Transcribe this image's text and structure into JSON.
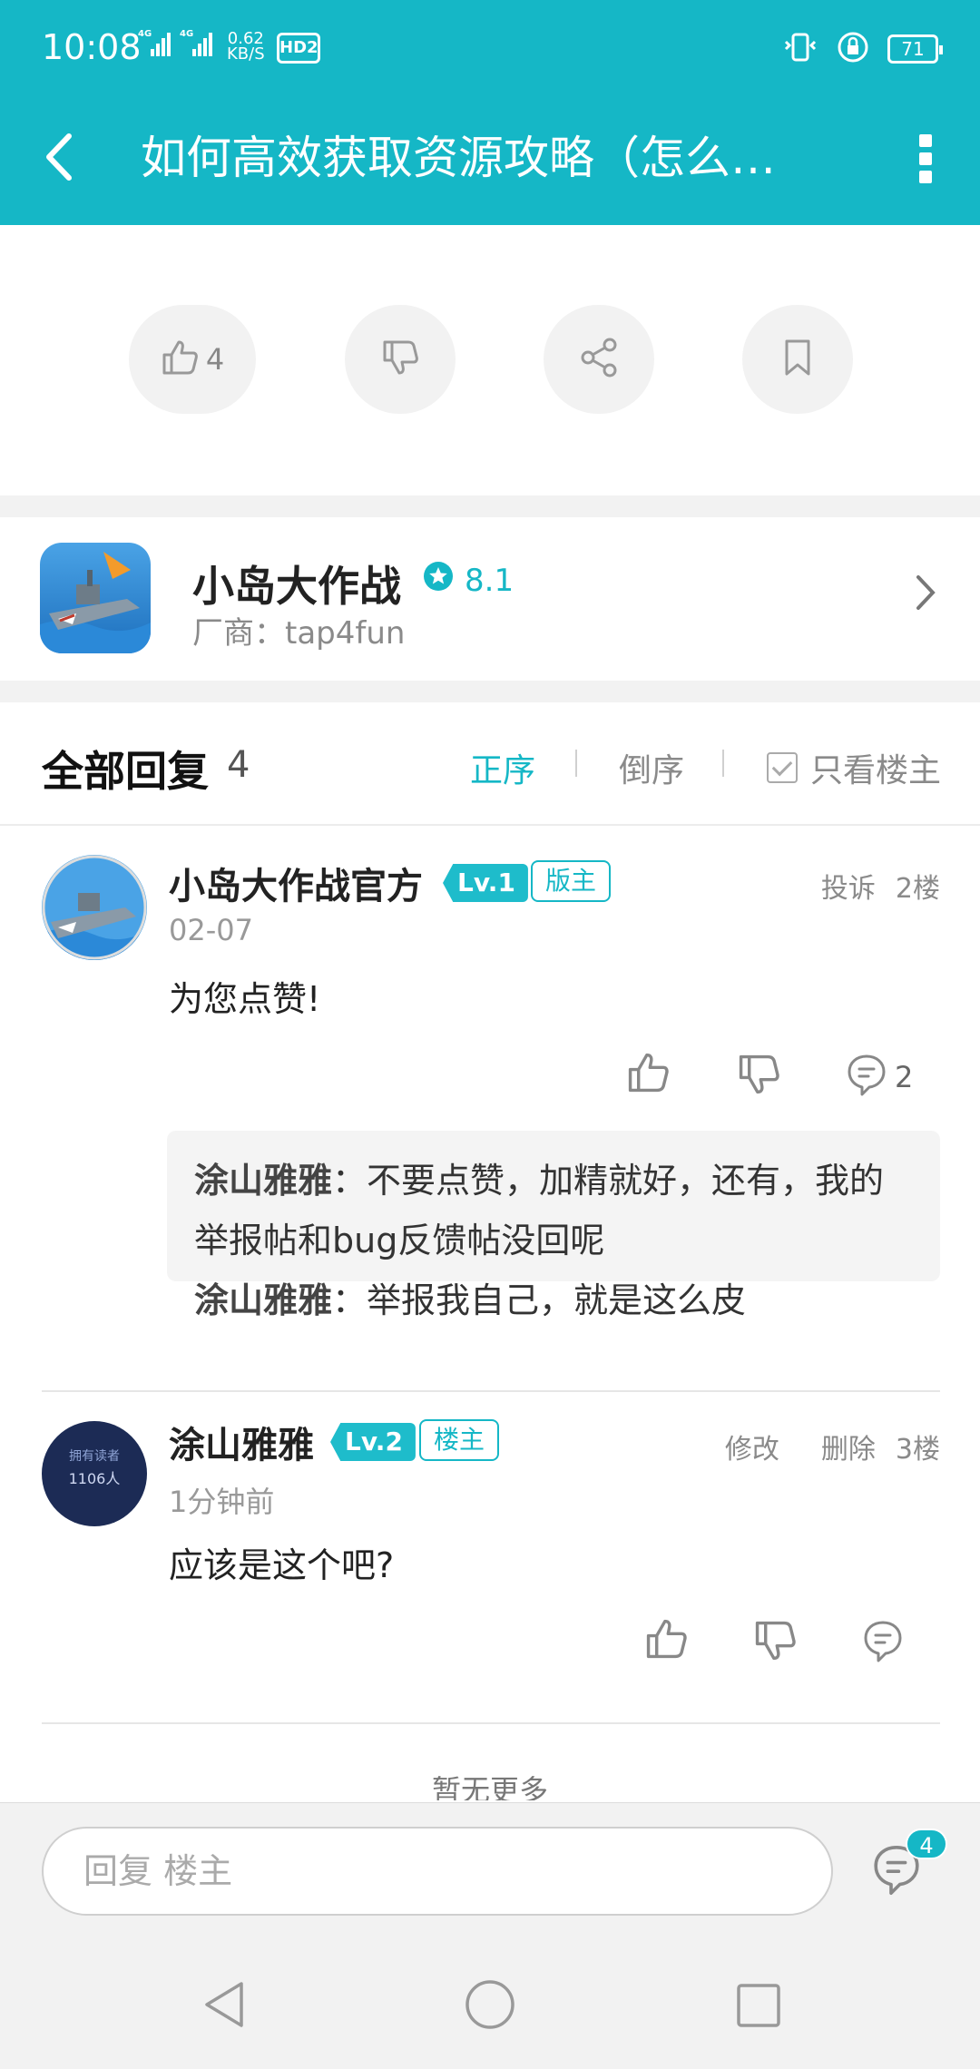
{
  "status_bar": {
    "time": "10:08",
    "signal": "4G 4G",
    "speed_value": "0.62",
    "speed_unit": "KB/S",
    "hd": "HD2",
    "battery": "71"
  },
  "toolbar": {
    "title": "如何高效获取资源攻略（怎么…",
    "back_icon": "back-arrow-icon",
    "more_icon": "more-vertical-icon"
  },
  "post_actions": {
    "like_count": "4",
    "icons": [
      "thumbs-up-icon",
      "thumbs-down-icon",
      "share-icon",
      "bookmark-icon"
    ]
  },
  "game": {
    "name": "小岛大作战",
    "rating": "8.1",
    "vendor": "厂商：tap4fun"
  },
  "replies_header": {
    "title": "全部回复",
    "count": "4",
    "sort_asc": "正序",
    "sort_desc": "倒序",
    "only_owner": "只看楼主"
  },
  "replies": [
    {
      "author": "小岛大作战官方",
      "level": "Lv.1",
      "role": "版主",
      "meta_actions": [
        "投诉",
        "2楼"
      ],
      "date": "02-07",
      "content": "为您点赞!",
      "comment_count": "2",
      "sub_replies": [
        {
          "author": "涂山雅雅",
          "text": "：不要点赞，加精就好，还有，我的举报帖和bug反馈帖没回呢"
        },
        {
          "author": "涂山雅雅",
          "text": "：举报我自己，就是这么皮"
        }
      ]
    },
    {
      "author": "涂山雅雅",
      "level": "Lv.2",
      "role": "楼主",
      "meta_actions": [
        "修改",
        "删除",
        "3楼"
      ],
      "date": "1分钟前",
      "content": "应该是这个吧?",
      "avatar_text_top": "拥有读者",
      "avatar_text_bottom": "1106人"
    }
  ],
  "no_more": "暂无更多",
  "bottom_bar": {
    "placeholder": "回复  楼主",
    "comments_badge": "4"
  },
  "colors": {
    "accent": "#15b7c6",
    "background": "#ffffff",
    "separator": "#f2f2f2"
  }
}
